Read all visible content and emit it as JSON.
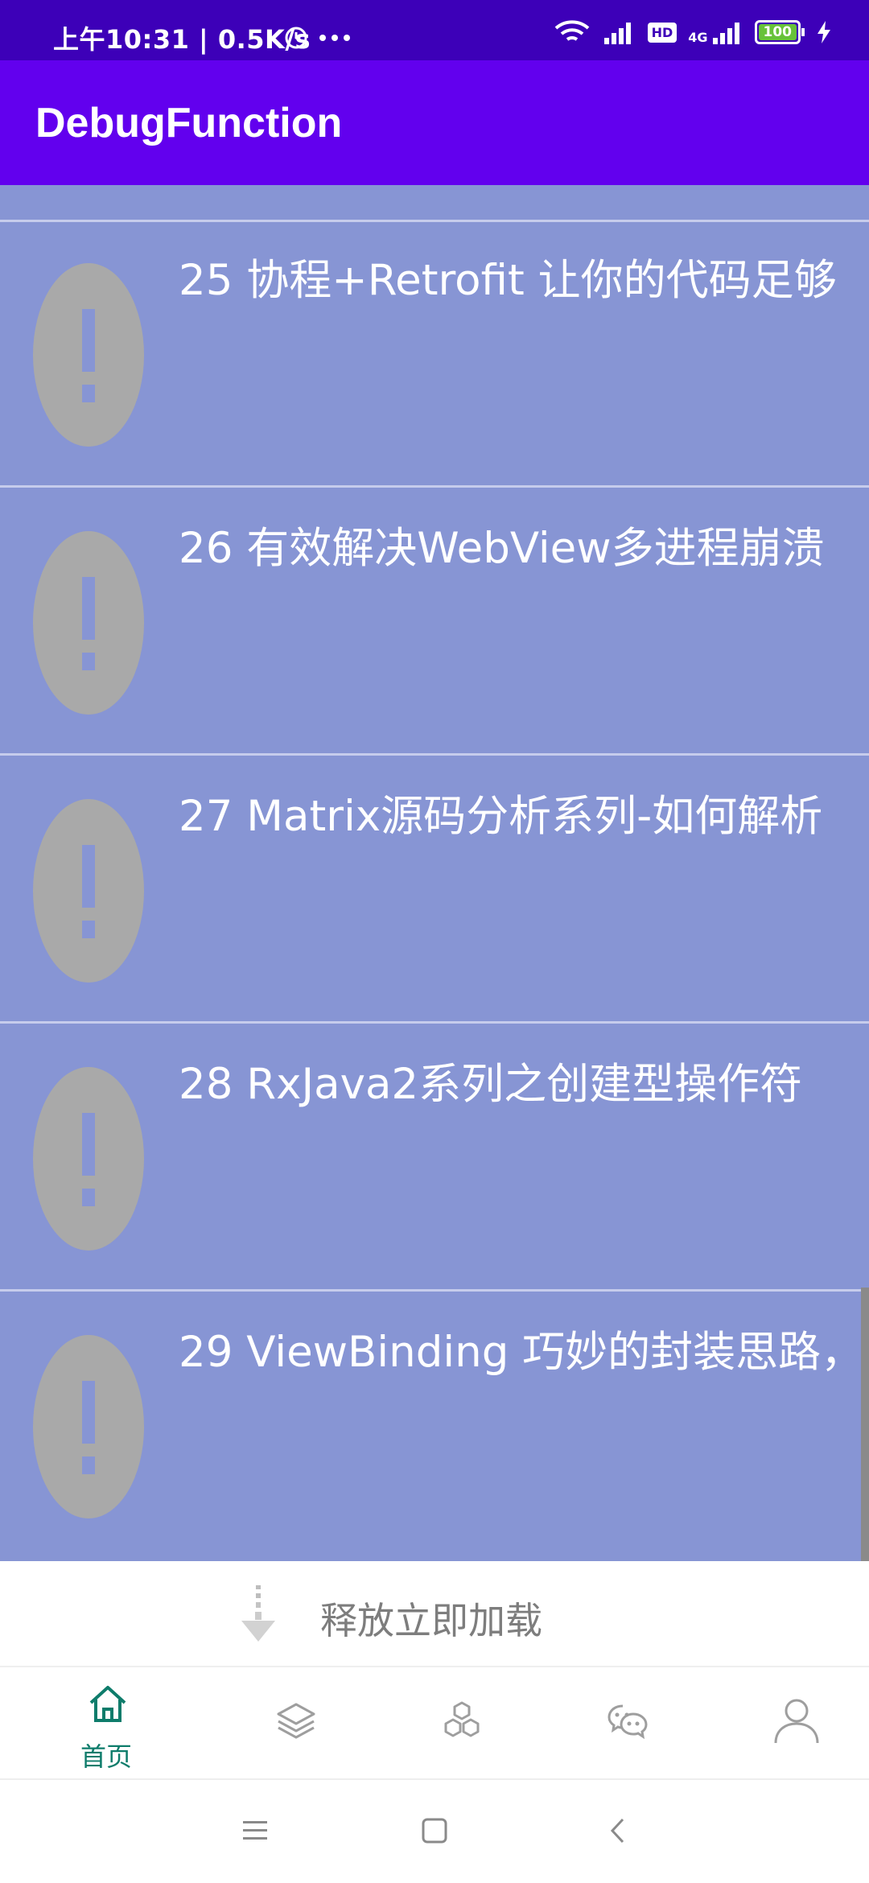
{
  "status_bar": {
    "time": "上午10:31 | 0.5K/s",
    "hd_badge": "HD",
    "network": "4G",
    "battery": "100",
    "icons": [
      "alarm-icon",
      "more-dots-icon",
      "wifi-icon",
      "signal-icon",
      "hd-icon",
      "4g-signal-icon",
      "battery-icon",
      "charging-icon"
    ]
  },
  "app_bar": {
    "title": "DebugFunction"
  },
  "list": {
    "items": [
      {
        "title": "25  协程+Retrofit 让你的代码足够",
        "thumb_icon": "error-placeholder-icon"
      },
      {
        "title": "26  有效解决WebView多进程崩溃",
        "thumb_icon": "error-placeholder-icon"
      },
      {
        "title": "27  Matrix源码分析系列-如何解析",
        "thumb_icon": "error-placeholder-icon"
      },
      {
        "title": "28  RxJava2系列之创建型操作符",
        "thumb_icon": "error-placeholder-icon"
      },
      {
        "title": "29  ViewBinding 巧妙的封装思路，",
        "thumb_icon": "error-placeholder-icon"
      }
    ],
    "colors": {
      "background": "#8795d4",
      "placeholder": "#a9a9a9"
    }
  },
  "loader": {
    "text": "释放立即加载",
    "icon": "arrow-down-icon"
  },
  "tabbar": {
    "tabs": [
      {
        "label": "首页",
        "icon": "home-icon",
        "selected": true
      },
      {
        "label": "",
        "icon": "layers-icon",
        "selected": false
      },
      {
        "label": "",
        "icon": "cubes-icon",
        "selected": false
      },
      {
        "label": "",
        "icon": "wechat-icon",
        "selected": false
      },
      {
        "label": "",
        "icon": "user-icon",
        "selected": false
      }
    ],
    "accent": "#0e7c6b"
  },
  "system_nav": {
    "icons": [
      "menu-icon",
      "home-square-icon",
      "back-icon"
    ]
  }
}
